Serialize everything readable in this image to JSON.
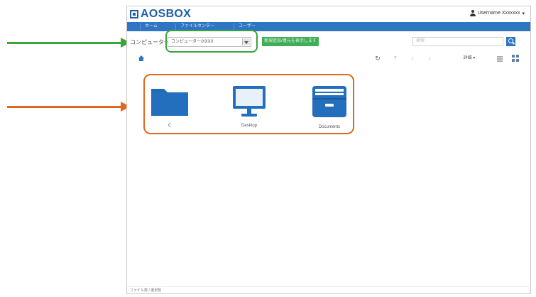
{
  "app": {
    "title": "AOSBOX"
  },
  "user": {
    "name": "Username Xxxxxxx"
  },
  "nav": {
    "tabs": [
      "ホーム",
      "ファイルセンター",
      "ユーザー"
    ]
  },
  "toolbar": {
    "breadcrumb_label": "コンピューター",
    "select_value": "コンピューター/XXXX",
    "green_button_label": "新規追加/復元を表示します",
    "search_placeholder": "検索",
    "view_label": "詳細"
  },
  "files": [
    {
      "name": "C",
      "icon": "folder-icon"
    },
    {
      "name": "Desktop",
      "icon": "monitor-icon"
    },
    {
      "name": "Documents",
      "icon": "archive-box-icon"
    }
  ],
  "status": {
    "text": "ファイル数 / 選択数"
  },
  "colors": {
    "brand": "#1d5ea7",
    "nav": "#2e76c2",
    "green": "#3fae57",
    "callout_green": "#3aa53a",
    "callout_orange": "#e06a1c"
  }
}
